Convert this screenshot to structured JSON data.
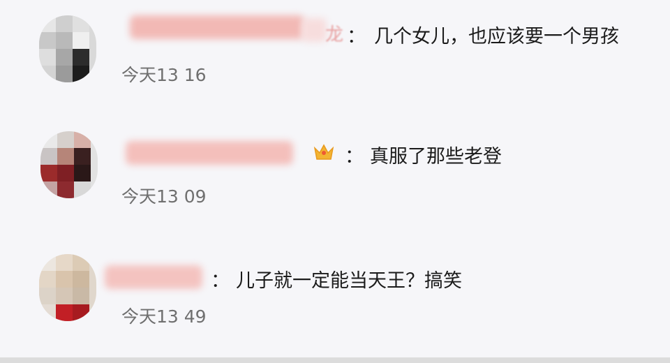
{
  "comments": [
    {
      "nick_tail": "龙",
      "text": "几个女儿，也应该要一个男孩",
      "time": "今天13 16"
    },
    {
      "text": "真服了那些老登",
      "time": "今天13 09"
    },
    {
      "nick_tail": "",
      "text": "儿子就一定能当天王？搞笑",
      "time": "今天13 49"
    }
  ],
  "colon": "：",
  "icons": {
    "badge": "crown-badge-icon"
  },
  "colors": {
    "background": "#f6f6f9",
    "nickname_blur": "#f2b7b7",
    "text": "#1b1b1b",
    "time": "#6f6f6f"
  }
}
